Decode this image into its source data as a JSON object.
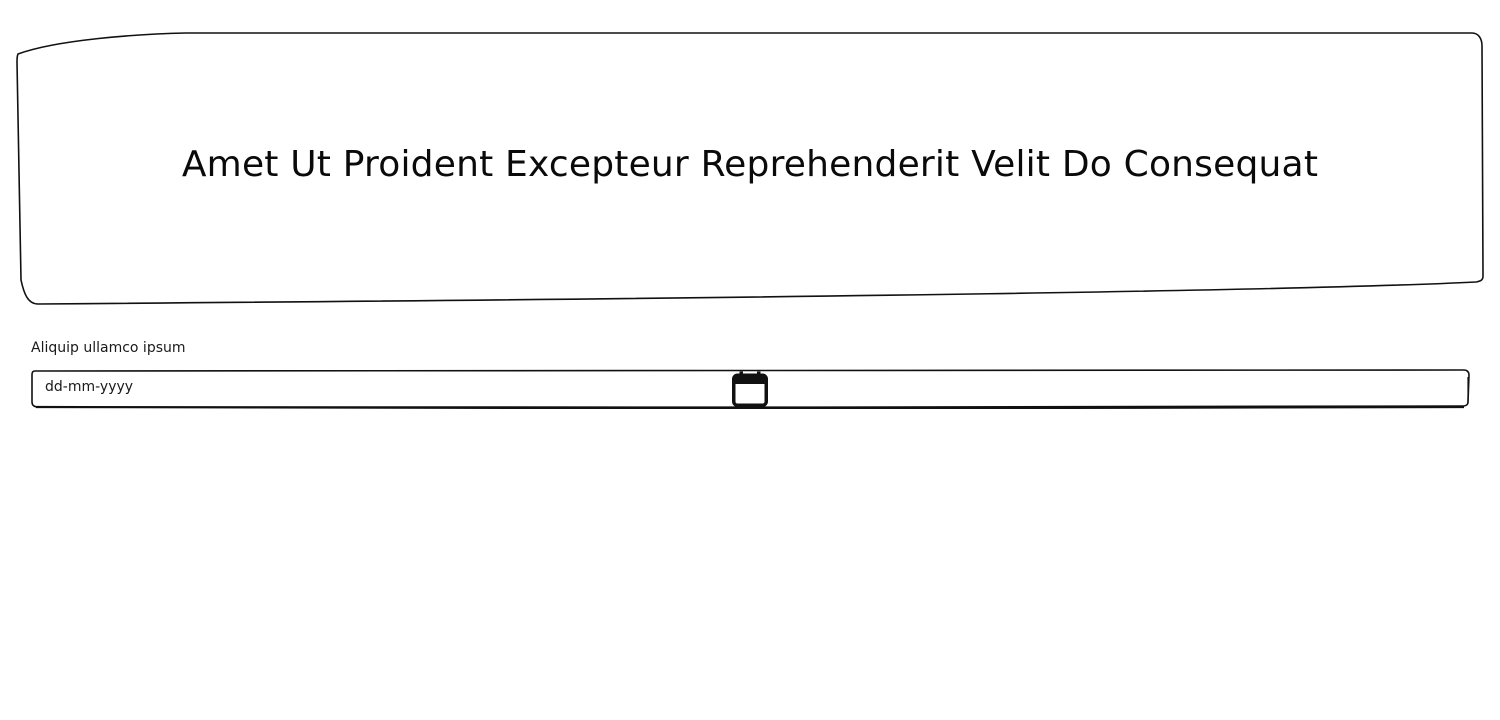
{
  "hero": {
    "title": "Amet Ut Proident Excepteur Reprehenderit Velit Do Consequat"
  },
  "date_field": {
    "label": "Aliquip ullamco ipsum",
    "placeholder": "dd-mm-yyyy",
    "icon": "calendar-icon"
  },
  "colors": {
    "stroke": "#111111",
    "background": "#ffffff"
  }
}
